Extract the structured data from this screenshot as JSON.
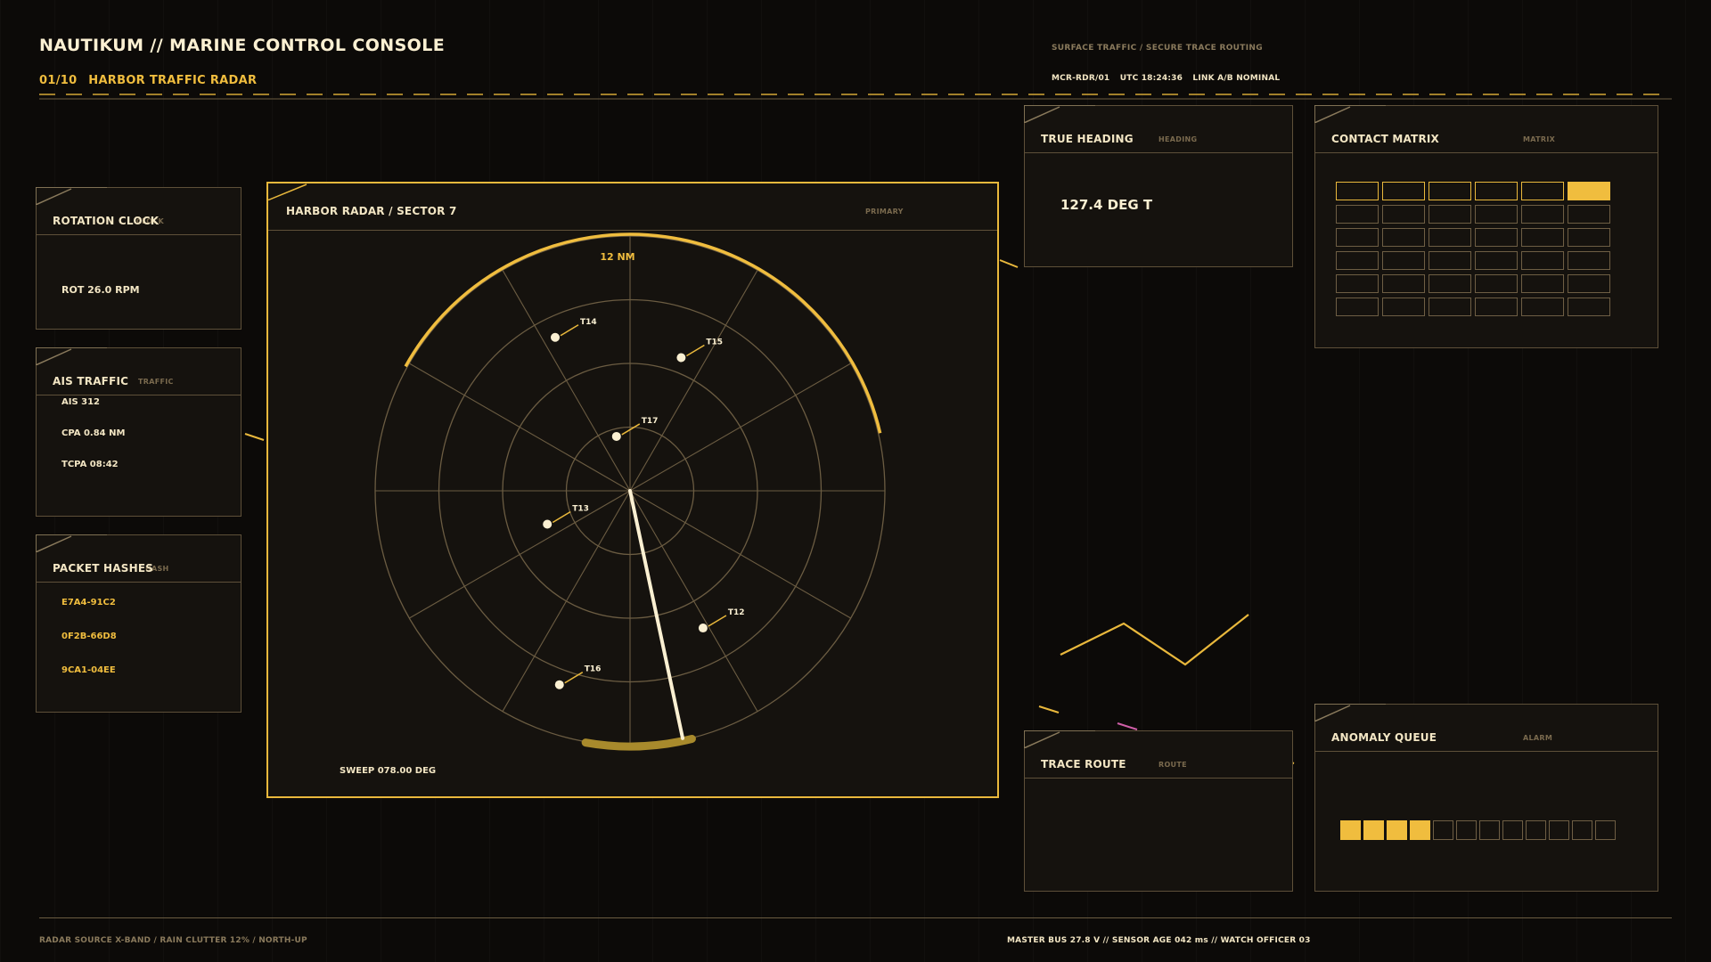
{
  "header": {
    "title": "NAUTIKUM // MARINE CONTROL CONSOLE",
    "section_index": "01/10",
    "section_title": "HARBOR TRAFFIC RADAR",
    "top_right_caption": "SURFACE TRAFFIC / SECURE TRACE ROUTING",
    "station_id": "MCR-RDR/01",
    "utc": "UTC 18:24:36",
    "link_status": "LINK A/B NOMINAL"
  },
  "panels": {
    "rotation_clock": {
      "title": "ROTATION CLOCK",
      "tag": "CLOCK",
      "value": "ROT 26.0 RPM"
    },
    "ais_traffic": {
      "title": "AIS TRAFFIC",
      "tag": "TRAFFIC",
      "rows": [
        "AIS 312",
        "CPA 0.84 NM",
        "TCPA 08:42"
      ]
    },
    "packet_hashes": {
      "title": "PACKET HASHES",
      "tag": "HASH",
      "rows": [
        "E7A4-91C2",
        "0F2B-66D8",
        "9CA1-04EE"
      ]
    },
    "radar": {
      "title": "HARBOR RADAR / SECTOR 7",
      "tag": "PRIMARY",
      "range_label": "12 NM",
      "sweep": "SWEEP 078.00 DEG"
    },
    "true_heading": {
      "title": "TRUE HEADING",
      "tag": "HEADING",
      "value": "127.4 DEG T"
    },
    "contact_matrix": {
      "title": "CONTACT MATRIX",
      "tag": "MATRIX",
      "active_cell": 5
    },
    "trace_route": {
      "title": "TRACE ROUTE",
      "tag": "ROUTE"
    },
    "anomaly_queue": {
      "title": "ANOMALY QUEUE",
      "tag": "ALARM",
      "filled": 4,
      "total": 12
    }
  },
  "radar_targets": [
    {
      "label": "T14",
      "bearing_deg": 334,
      "range_frac": 0.67
    },
    {
      "label": "T15",
      "bearing_deg": 21,
      "range_frac": 0.56
    },
    {
      "label": "T17",
      "bearing_deg": 346,
      "range_frac": 0.22
    },
    {
      "label": "T13",
      "bearing_deg": 248,
      "range_frac": 0.35
    },
    {
      "label": "T12",
      "bearing_deg": 152,
      "range_frac": 0.61
    },
    {
      "label": "T16",
      "bearing_deg": 200,
      "range_frac": 0.81
    }
  ],
  "colors": {
    "accent": "#f0bd3e",
    "bright": "#fbf0d2",
    "line": "#6b5c42",
    "alert": "#d05fa8",
    "bg": "#0c0a08"
  },
  "footer": {
    "left": "RADAR SOURCE X-BAND / RAIN CLUTTER 12% / NORTH-UP",
    "right": "MASTER BUS 27.8 V  //  SENSOR AGE 042 ms  //  WATCH OFFICER 03"
  }
}
